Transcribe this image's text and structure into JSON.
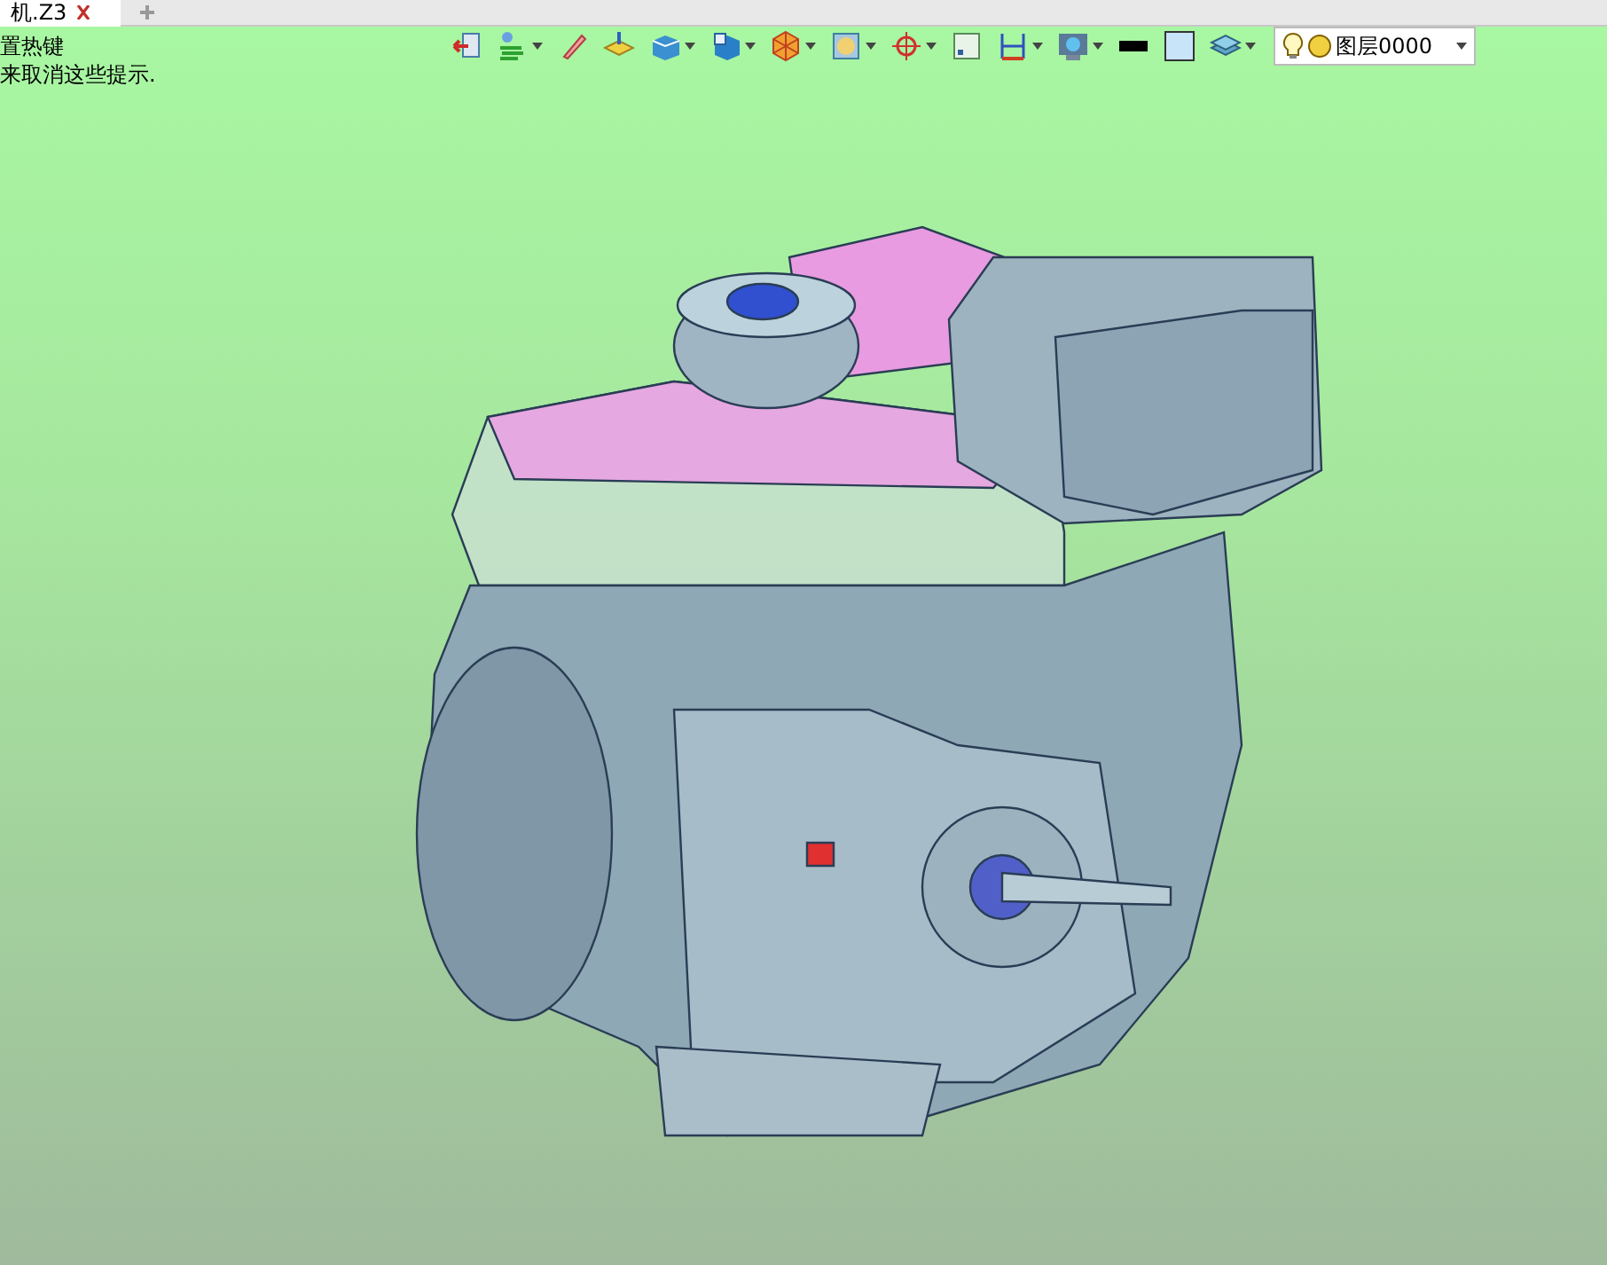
{
  "tabs": [
    {
      "title": "机.Z3",
      "selected": true
    }
  ],
  "hints": [
    "置热键",
    "来取消这些提示."
  ],
  "toolbar": [
    {
      "has_menu": false
    },
    {
      "has_menu": true
    },
    {
      "has_menu": false
    },
    {
      "has_menu": false
    },
    {
      "has_menu": true
    },
    {
      "has_menu": true
    },
    {
      "has_menu": true
    },
    {
      "has_menu": true
    },
    {
      "has_menu": true
    },
    {
      "has_menu": false
    },
    {
      "has_menu": true
    },
    {
      "has_menu": true
    },
    {
      "has_menu": false
    },
    {
      "has_menu": false
    },
    {
      "has_menu": true
    }
  ],
  "layer_selector": {
    "value": "图层0000"
  }
}
